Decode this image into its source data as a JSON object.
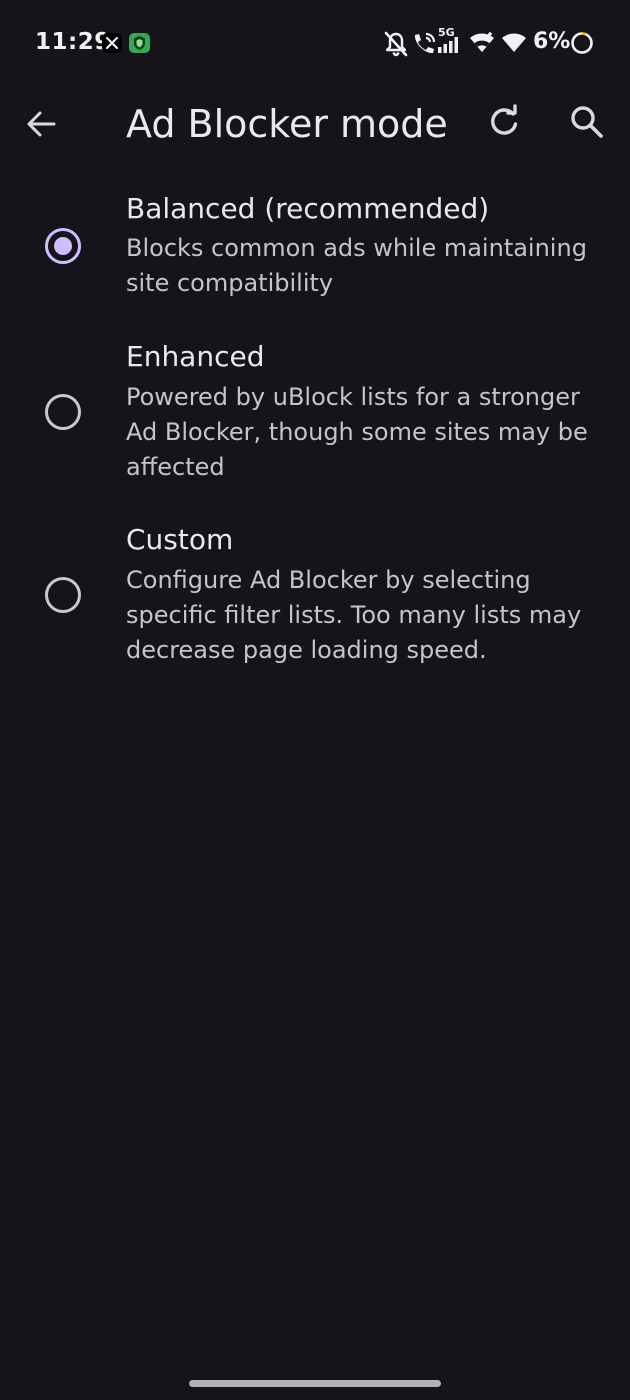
{
  "status_bar": {
    "time": "11:29",
    "notification_icons": [
      "x-app-icon",
      "vpn-shield-icon"
    ],
    "system_icons": [
      "bell-off-icon",
      "wifi-calling-icon",
      "signal-5g-icon",
      "wifi-icon",
      "wifi-icon"
    ],
    "network_label": "5G",
    "battery_percent": "6%",
    "battery_level": 0.06
  },
  "app_bar": {
    "title": "Ad Blocker mode",
    "actions": [
      "arrow-back-icon",
      "refresh-icon",
      "search-icon"
    ]
  },
  "options": [
    {
      "title": "Balanced (recommended)",
      "description": "Blocks common ads while maintaining site compatibility",
      "selected": true
    },
    {
      "title": "Enhanced",
      "description": "Powered by uBlock lists for a stronger Ad Blocker, though some sites may be affected",
      "selected": false
    },
    {
      "title": "Custom",
      "description": "Configure Ad Blocker by selecting specific filter lists. Too many lists may decrease page loading speed.",
      "selected": false
    }
  ],
  "colors": {
    "background": "#15141a",
    "accent": "#cfbdfe",
    "text_primary": "#ebe7ee",
    "text_secondary": "#c7c3cc"
  }
}
